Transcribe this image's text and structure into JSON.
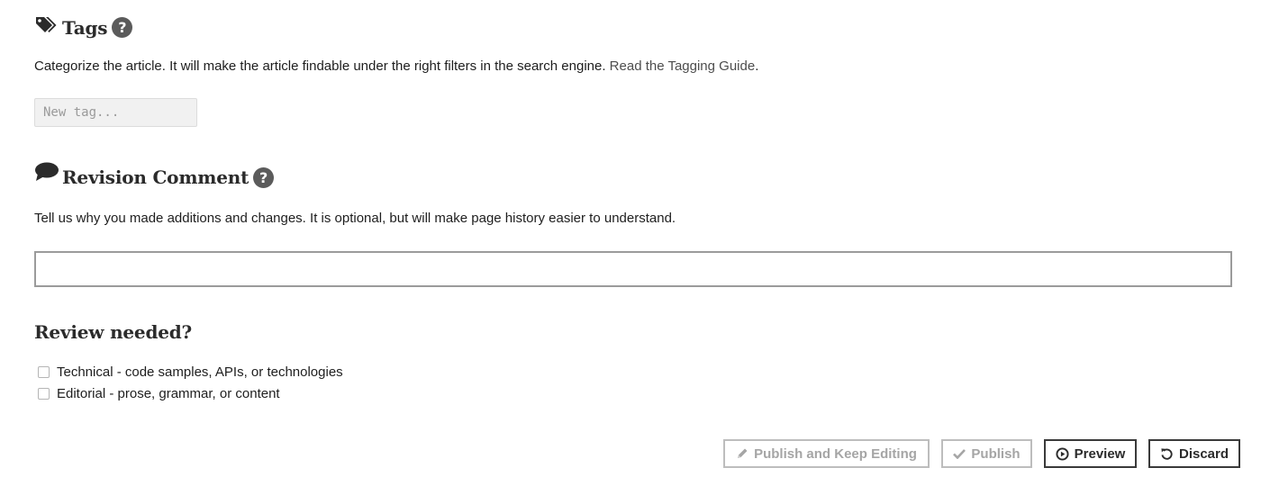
{
  "tags": {
    "title": "Tags",
    "help_glyph": "?",
    "description": "Categorize the article. It will make the article findable under the right filters in the search engine.",
    "guide_link": "Read the Tagging Guide",
    "guide_suffix": ".",
    "input_placeholder": "New tag...",
    "icon": "tags-icon"
  },
  "revision": {
    "title": "Revision Comment",
    "help_glyph": "?",
    "description": "Tell us why you made additions and changes. It is optional, but will make page history easier to understand.",
    "input_value": "",
    "icon": "comment-bubble-icon"
  },
  "review": {
    "title": "Review needed?",
    "options": [
      {
        "label": "Technical - code samples, APIs, or technologies",
        "checked": false
      },
      {
        "label": "Editorial - prose, grammar, or content",
        "checked": false
      }
    ]
  },
  "actions": {
    "publish_keep_label": "Publish and Keep Editing",
    "publish_label": "Publish",
    "preview_label": "Preview",
    "discard_label": "Discard",
    "publish_keep_enabled": false,
    "publish_enabled": false,
    "icons": [
      "pencil-icon",
      "checkmark-icon",
      "play-circle-icon",
      "undo-icon"
    ]
  },
  "colors": {
    "text": "#222222",
    "help_icon_bg": "#5b5b5b",
    "disabled_border": "#bdbdbd",
    "disabled_text": "#a5a5a5",
    "button_border": "#3a3a3a"
  }
}
